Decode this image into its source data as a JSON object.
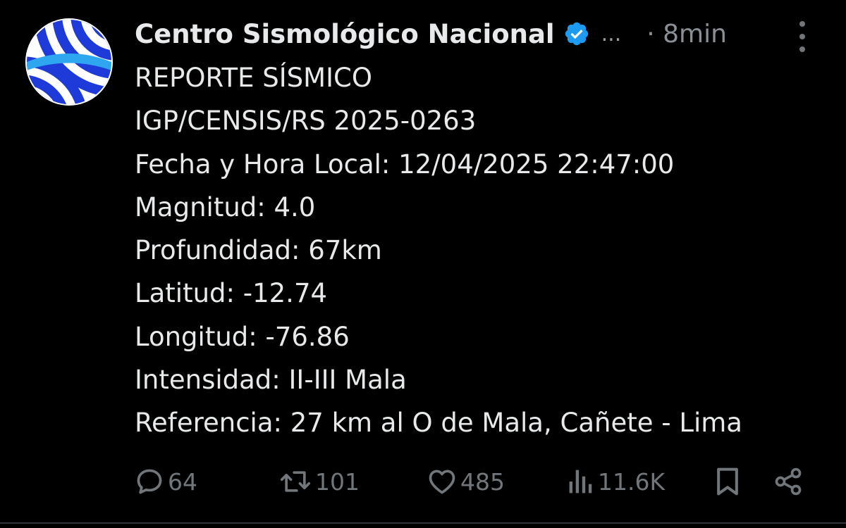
{
  "colors": {
    "background": "#000000",
    "text": "#e7e9ea",
    "muted": "#71767b",
    "verified": "#1d9bf0",
    "avatar_blue": "#1e3ad8"
  },
  "author": {
    "name": "Centro Sismológico Nacional",
    "verified_icon": "verified-badge-icon",
    "ellipsis": "...",
    "timestamp": "· 8min"
  },
  "content": {
    "lines": [
      "REPORTE SÍSMICO",
      "IGP/CENSIS/RS 2025-0263",
      "Fecha y Hora Local: 12/04/2025 22:47:00",
      "Magnitud: 4.0",
      "Profundidad: 67km",
      "Latitud: -12.74",
      "Longitud: -76.86",
      "Intensidad: II-III Mala",
      "Referencia: 27 km al O de Mala, Cañete - Lima"
    ]
  },
  "actions": {
    "replies": "64",
    "reposts": "101",
    "likes": "485",
    "views": "11.6K",
    "icons": [
      "reply-icon",
      "repost-icon",
      "like-icon",
      "views-icon",
      "bookmark-icon",
      "share-icon"
    ]
  }
}
